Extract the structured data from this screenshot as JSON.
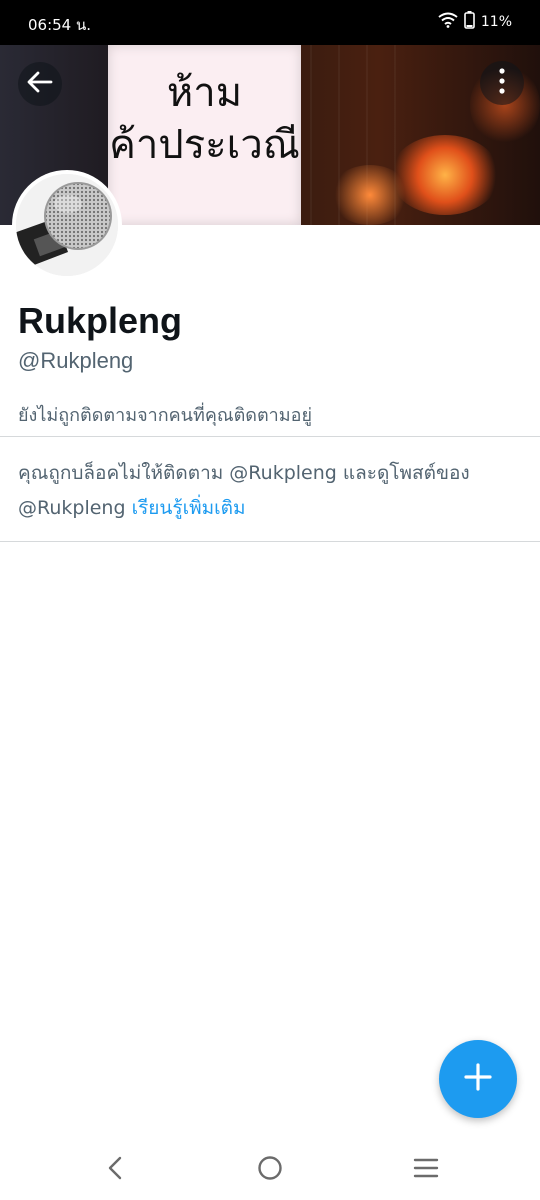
{
  "status_bar": {
    "time": "06:54 น.",
    "battery": "11%"
  },
  "banner": {
    "sign_line1": "ห้าม",
    "sign_line2": "ค้าประเวณี"
  },
  "profile": {
    "name": "Rukpleng",
    "handle": "@Rukpleng",
    "follow_status": "ยังไม่ถูกติดตามจากคนที่คุณติดตามอยู่"
  },
  "blocked_notice": {
    "text": "คุณถูกบล็อคไม่ให้ติดตาม @Rukpleng และดูโพสต์ของ @Rukpleng",
    "link": "เรียนรู้เพิ่มเติม"
  },
  "icons": {
    "back": "arrow-left-icon",
    "more": "more-vertical-icon",
    "fab": "plus-icon",
    "nav_back": "chevron-left-icon",
    "nav_home": "circle-home-icon",
    "nav_menu": "menu-icon"
  },
  "colors": {
    "accent": "#1d9bf0",
    "secondary_text": "#536471",
    "primary_text": "#0f1419"
  }
}
